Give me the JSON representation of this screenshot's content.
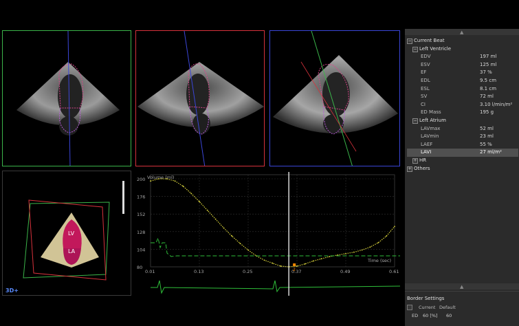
{
  "viewports": {
    "three_d": {
      "label": "3D+",
      "lv": "LV",
      "la": "LA"
    }
  },
  "chart": {
    "y_title": "Volume (ml)",
    "x_title": "Time (sec)",
    "y_ticks": [
      "200",
      "176",
      "152",
      "128",
      "104",
      "80"
    ],
    "x_ticks": [
      "0.01",
      "0.13",
      "0.25",
      "0.37",
      "0.49",
      "0.61"
    ],
    "marker_label": "2"
  },
  "chart_data": {
    "type": "line",
    "title": "",
    "xlabel": "Time (sec)",
    "ylabel": "Volume (ml)",
    "xlim": [
      0.01,
      0.61
    ],
    "ylim": [
      80,
      200
    ],
    "series": [
      {
        "x": [
          0.01,
          0.03,
          0.05,
          0.07,
          0.09,
          0.11,
          0.13,
          0.15,
          0.17,
          0.19,
          0.21,
          0.23,
          0.25,
          0.27,
          0.29,
          0.31,
          0.33,
          0.35,
          0.37,
          0.39,
          0.41,
          0.43,
          0.45,
          0.47,
          0.49,
          0.51,
          0.53,
          0.55,
          0.57,
          0.59,
          0.61
        ],
        "y": [
          197,
          200,
          200,
          197,
          190,
          180,
          169,
          157,
          145,
          133,
          122,
          112,
          103,
          95,
          89,
          85,
          81,
          80,
          81,
          84,
          88,
          91,
          94,
          96,
          98,
          100,
          103,
          107,
          113,
          122,
          135
        ]
      }
    ],
    "grid": true
  },
  "panel": {
    "root_label": "Current Beat",
    "lv_label": "Left Ventricle",
    "lv_items": [
      {
        "name": "EDV",
        "value": "197 ml"
      },
      {
        "name": "ESV",
        "value": "125 ml"
      },
      {
        "name": "EF",
        "value": "37 %"
      },
      {
        "name": "EDL",
        "value": "9.5 cm"
      },
      {
        "name": "ESL",
        "value": "8.1 cm"
      },
      {
        "name": "SV",
        "value": "72 ml"
      },
      {
        "name": "CI",
        "value": "3.10 l/min/m²"
      },
      {
        "name": "ED Mass",
        "value": "195 g"
      }
    ],
    "la_label": "Left Atrium",
    "la_items": [
      {
        "name": "LAVmax",
        "value": "52 ml"
      },
      {
        "name": "LAVmin",
        "value": "23 ml"
      },
      {
        "name": "LAEF",
        "value": "55 %"
      },
      {
        "name": "LAVI",
        "value": "27 ml/m²"
      }
    ],
    "hr_label": "HR",
    "others_label": "Others",
    "border_settings": {
      "title": "Border Settings",
      "current": "Current",
      "default": "Default",
      "ed_label": "ED",
      "ed_current": "60 [%]",
      "ed_default": "60"
    }
  },
  "colors": {
    "green": "#3bb54a",
    "red": "#d8323c",
    "blue": "#3b46d8",
    "contour_magenta": "#d9458a",
    "curve_yellow": "#d8d23a",
    "ecg_green": "#2fbf3a"
  }
}
